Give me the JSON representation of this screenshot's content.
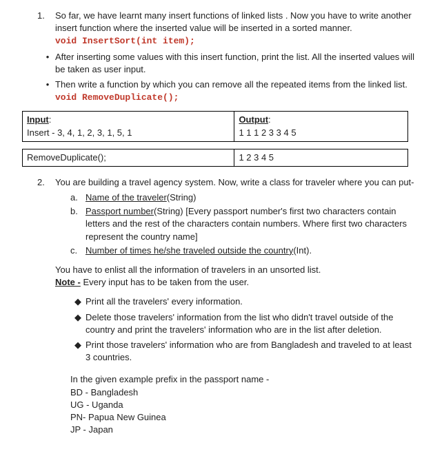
{
  "q1": {
    "num": "1.",
    "intro": "So far, we have learnt many insert functions of linked lists . Now you have to write another insert function where the inserted value will be inserted in a sorted manner.",
    "code1": "void InsertSort(int item);",
    "b1": "After inserting some values with this insert function, print the list. All the inserted values will be taken as user input.",
    "b2": "Then write a function by which you can remove all the repeated items from the linked list.",
    "code2": "void RemoveDuplicate();"
  },
  "table1": {
    "in_label": "Input",
    "in_val": "Insert - 3, 4, 1, 2, 3, 1, 5, 1",
    "out_label": "Output",
    "out_val": "1 1 1 2 3 3 4 5"
  },
  "table2": {
    "in_val": "RemoveDuplicate();",
    "out_val": "1 2 3 4 5"
  },
  "q2": {
    "num": "2.",
    "intro": "You are building a travel agency system. Now, write a class for traveler  where you can put-",
    "a_mark": "a.",
    "a_u": "Name of the traveler",
    "a_rest": "(String)",
    "b_mark": "b.",
    "b_u": "Passport number",
    "b_rest": "(String) [Every passport number's first two characters contain letters and the rest of the characters contain numbers. Where first two characters represent the country name]",
    "c_mark": "c.",
    "c_u": "Number of times he/she traveled outside the country",
    "c_rest": "(Int).",
    "para1": "You have to enlist all the information of travelers in an unsorted list.",
    "note_label": "Note -",
    "note_text": " Every input has to be taken from the user.",
    "d1": "Print all the travelers' every information.",
    "d2": "Delete those travelers' information from the list who didn't travel outside of the country and print the travelers' information who are in the list after deletion.",
    "d3": "Print those travelers' information who are from Bangladesh and traveled to at least 3 countries.",
    "prefix_intro": "In the given example prefix in the passport name -",
    "p1": "BD - Bangladesh",
    "p2": "UG - Uganda",
    "p3": "PN- Papua New Guinea",
    "p4": "JP - Japan"
  }
}
